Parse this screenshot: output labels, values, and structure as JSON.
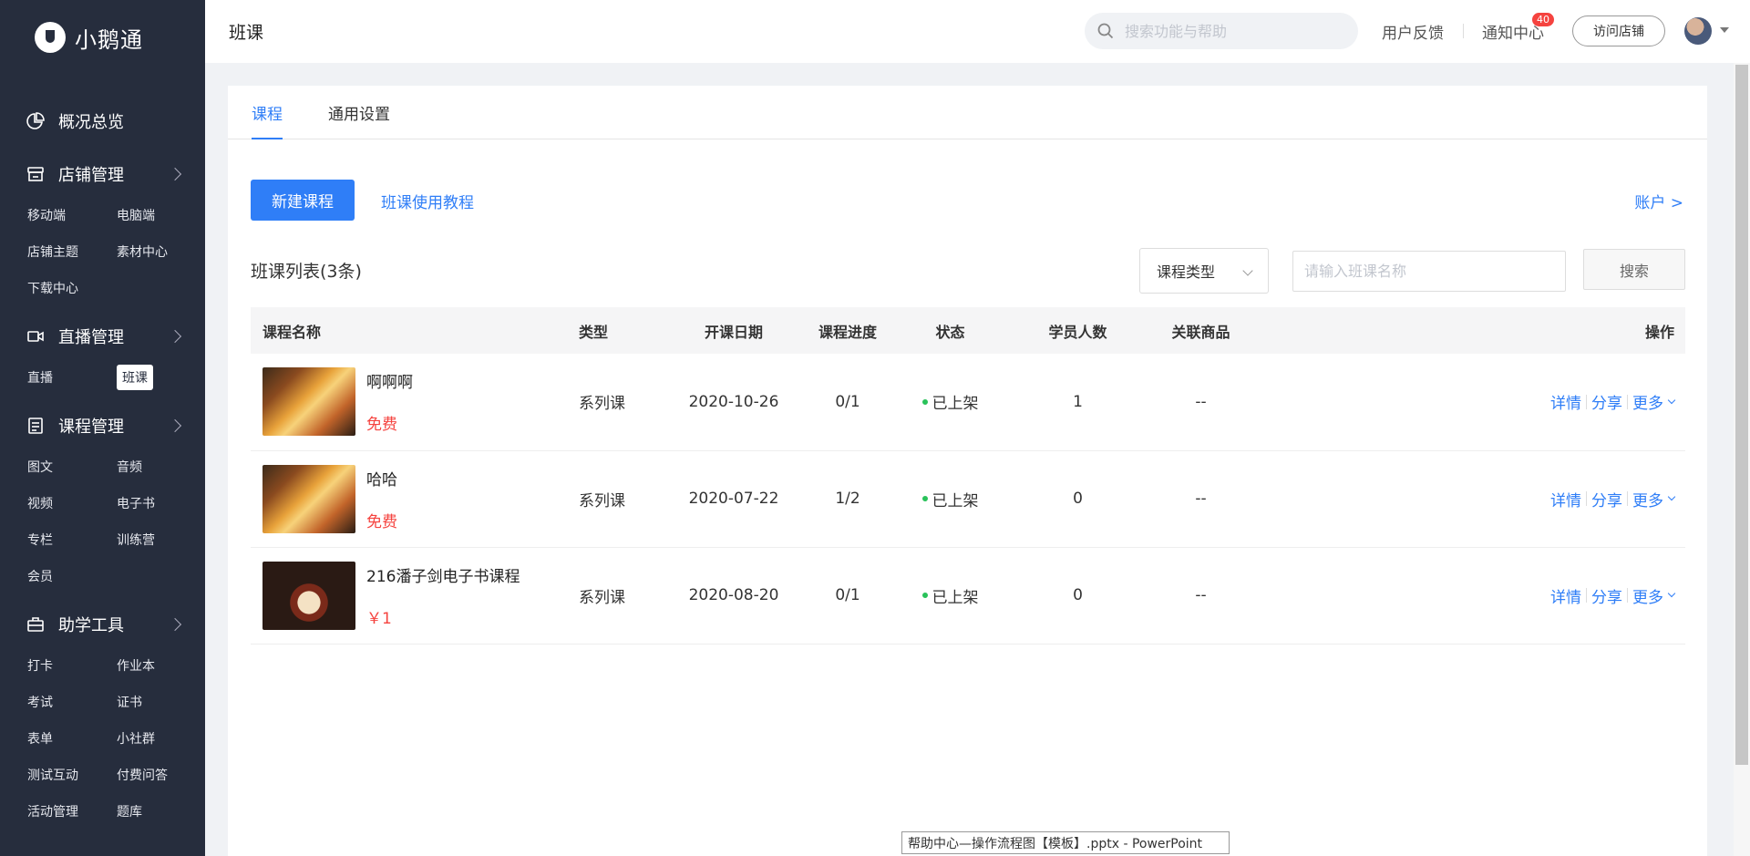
{
  "app": {
    "logo_text": "小鹅通"
  },
  "sidebar": {
    "groups": [
      {
        "label": "概况总览",
        "icon": "pie-chart-icon",
        "items": []
      },
      {
        "label": "店铺管理",
        "icon": "store-icon",
        "items": [
          "移动端",
          "电脑端",
          "店铺主题",
          "素材中心",
          "下载中心"
        ]
      },
      {
        "label": "直播管理",
        "icon": "video-camera-icon",
        "items": [
          "直播",
          "班课"
        ],
        "active_item": "班课"
      },
      {
        "label": "课程管理",
        "icon": "document-icon",
        "items": [
          "图文",
          "音频",
          "视频",
          "电子书",
          "专栏",
          "训练营",
          "会员"
        ]
      },
      {
        "label": "助学工具",
        "icon": "toolbox-icon",
        "items": [
          "打卡",
          "作业本",
          "考试",
          "证书",
          "表单",
          "小社群",
          "测试互动",
          "付费问答",
          "活动管理",
          "题库"
        ]
      }
    ]
  },
  "header": {
    "title": "班课",
    "search_placeholder": "搜索功能与帮助",
    "feedback": "用户反馈",
    "notifications": "通知中心",
    "notifications_badge": "40",
    "visit_store": "访问店铺"
  },
  "tabs": [
    {
      "label": "课程",
      "active": true
    },
    {
      "label": "通用设置",
      "active": false
    }
  ],
  "actions": {
    "new_course": "新建课程",
    "tutorial": "班课使用教程",
    "account": "账户 >"
  },
  "list": {
    "title": "班课列表(3条)",
    "type_filter": "课程类型",
    "name_placeholder": "请输入班课名称",
    "search_button": "搜索"
  },
  "table": {
    "columns": [
      "课程名称",
      "类型",
      "开课日期",
      "课程进度",
      "状态",
      "学员人数",
      "关联商品",
      "操作"
    ],
    "rows": [
      {
        "name": "啊啊啊",
        "price": "免费",
        "type": "系列课",
        "date": "2020-10-26",
        "progress": "0/1",
        "status": "已上架",
        "students": "1",
        "product": "--",
        "thumb": "autumn"
      },
      {
        "name": "哈哈",
        "price": "免费",
        "type": "系列课",
        "date": "2020-07-22",
        "progress": "1/2",
        "status": "已上架",
        "students": "0",
        "product": "--",
        "thumb": "autumn"
      },
      {
        "name": "216潘子剑电子书课程",
        "price": "￥1",
        "type": "系列课",
        "date": "2020-08-20",
        "progress": "0/1",
        "status": "已上架",
        "students": "0",
        "product": "--",
        "thumb": "pirate"
      }
    ],
    "op_detail": "详情",
    "op_share": "分享",
    "op_more": "更多"
  },
  "taskbar_tooltip": "帮助中心—操作流程图【模板】.pptx - PowerPoint",
  "colors": {
    "accent": "#2f7ef7",
    "sidebar_bg": "#262d3d",
    "price_red": "#f5433f",
    "status_green": "#29c25a"
  }
}
